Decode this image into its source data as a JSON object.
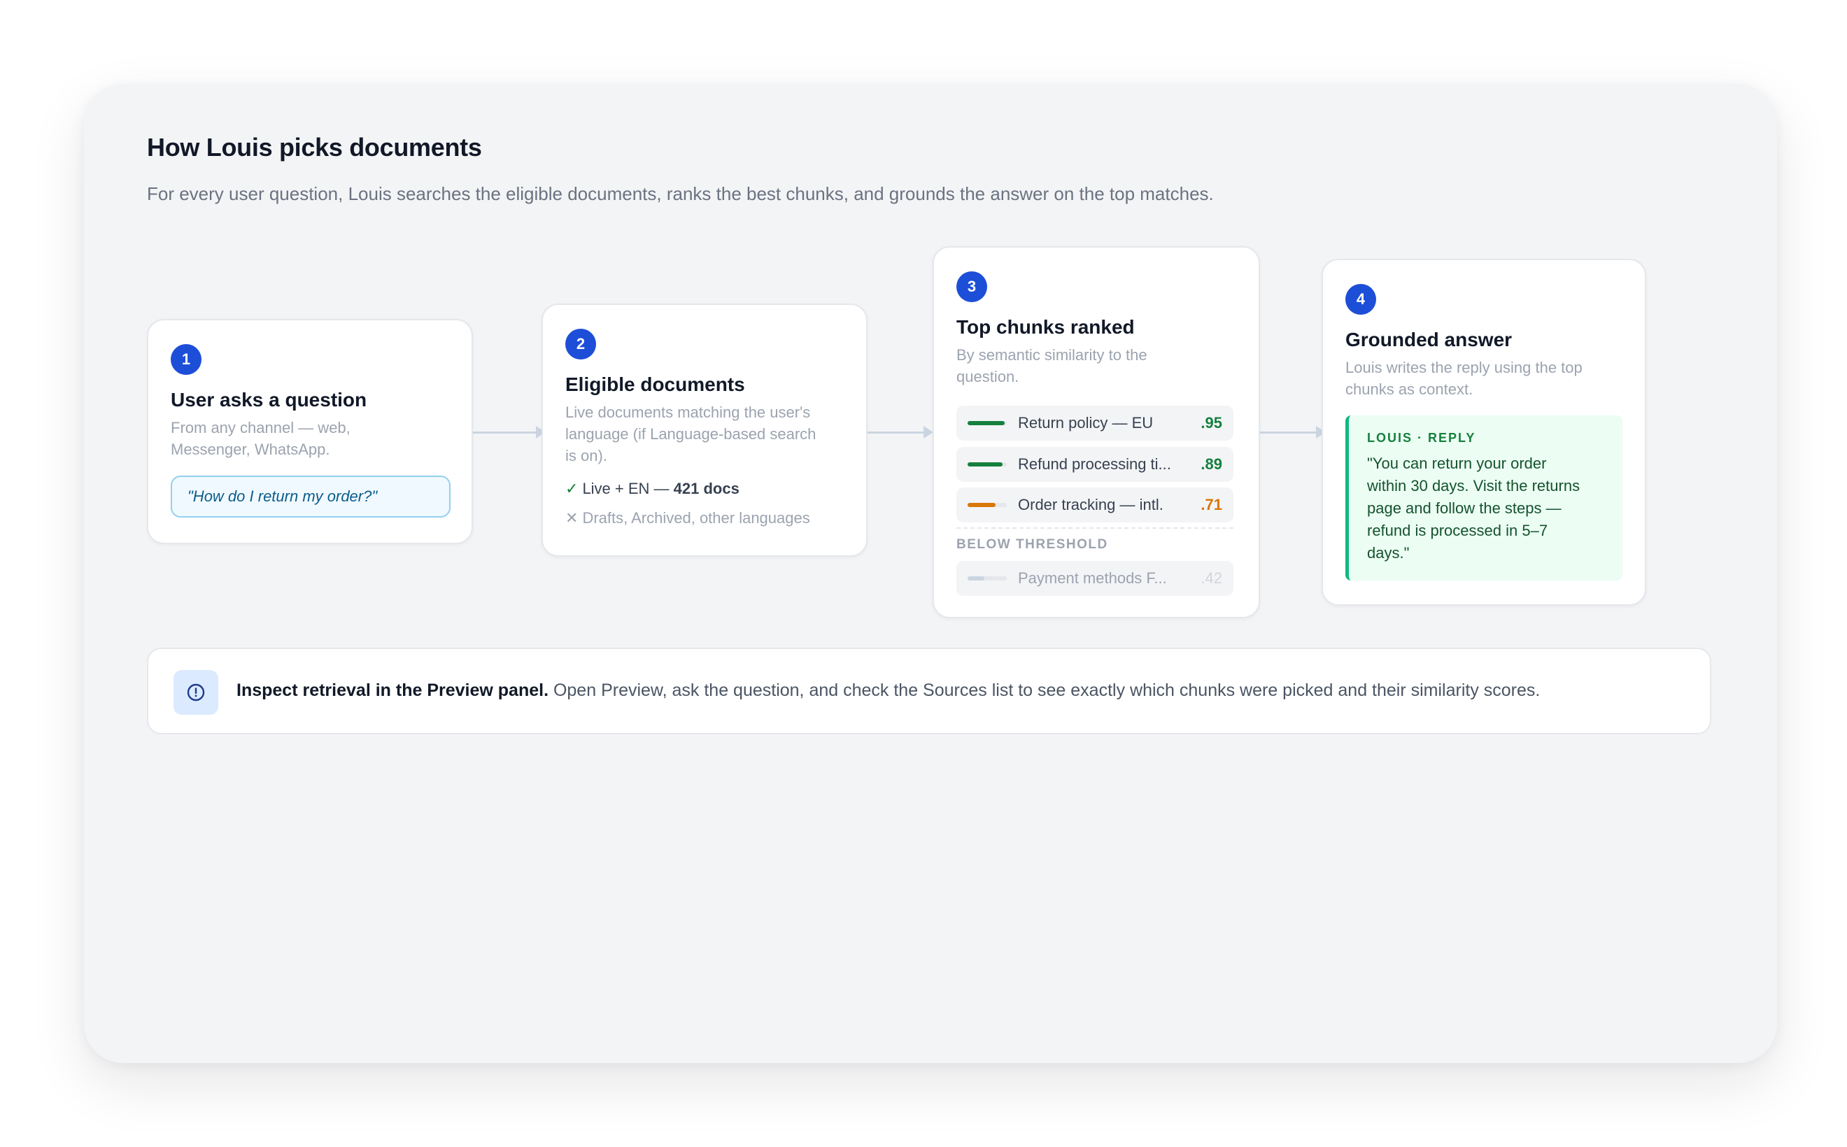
{
  "header": {
    "title": "How Louis picks documents",
    "subtitle": "For every user question, Louis searches the eligible documents, ranks the best chunks, and grounds the answer on the top matches."
  },
  "steps": [
    {
      "number": "1",
      "title": "User asks a question",
      "desc_lines": [
        "From any channel — web,",
        "Messenger, WhatsApp."
      ],
      "example": "\"How do I return my order?\""
    },
    {
      "number": "2",
      "title": "Eligible documents",
      "desc_lines": [
        "Live documents matching the user's",
        "language (if Language-based search",
        "is on)."
      ],
      "included_mark": "✓",
      "included_prefix": "Live + EN — ",
      "included_count": "421 docs",
      "excluded_mark": "✕",
      "excluded": "Drafts, Archived, other languages"
    },
    {
      "number": "3",
      "title": "Top chunks ranked",
      "desc_lines": [
        "By semantic similarity to the",
        "question."
      ],
      "chunks": [
        {
          "label": "Return policy — EU",
          "score": ".95",
          "similarity": 0.95,
          "color": "#15803d"
        },
        {
          "label": "Refund processing ti...",
          "score": ".89",
          "similarity": 0.89,
          "color": "#15803d"
        },
        {
          "label": "Order tracking — intl.",
          "score": ".71",
          "similarity": 0.71,
          "color": "#d97706"
        }
      ],
      "below_threshold_label": "BELOW THRESHOLD",
      "below_chunks": [
        {
          "label": "Payment methods F...",
          "score": ".42",
          "similarity": 0.42,
          "color": "#cbd5e1"
        }
      ]
    },
    {
      "number": "4",
      "title": "Grounded answer",
      "desc_lines": [
        "Louis writes the reply using the top",
        "chunks as context."
      ],
      "reply_label": "LOUIS · REPLY",
      "reply_lines": [
        "\"You can return your order",
        "within 30 days. Visit the returns",
        "page and follow the steps —",
        "refund is processed in 5–7",
        "days.\""
      ]
    }
  ],
  "tip": {
    "icon": "info-icon",
    "bold": "Inspect retrieval in the Preview panel.",
    "text": " Open Preview, ask the question, and check the Sources list to see exactly which chunks were picked and their similarity scores."
  },
  "colors": {
    "accent": "#1d4ed8",
    "high_score": "#15803d",
    "mid_score": "#d97706",
    "low_score": "#cbd5e1",
    "reply_border": "#10b981"
  }
}
